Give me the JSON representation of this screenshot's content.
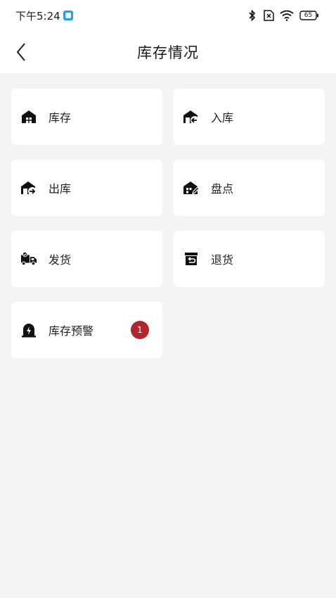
{
  "status_bar": {
    "time": "下午5:24",
    "battery": "65",
    "icons": [
      "app-notification-icon",
      "bluetooth-icon",
      "sim-off-icon",
      "wifi-icon",
      "battery-icon"
    ]
  },
  "nav": {
    "back_icon": "chevron-left-icon",
    "title": "库存情况"
  },
  "menu": {
    "items": [
      {
        "label": "库存",
        "icon": "warehouse-icon"
      },
      {
        "label": "入库",
        "icon": "warehouse-in-icon"
      },
      {
        "label": "出库",
        "icon": "warehouse-out-icon"
      },
      {
        "label": "盘点",
        "icon": "inventory-check-icon"
      },
      {
        "label": "发货",
        "icon": "delivery-truck-icon"
      },
      {
        "label": "退货",
        "icon": "return-box-icon"
      },
      {
        "label": "库存预警",
        "icon": "alert-warehouse-icon",
        "badge": "1"
      }
    ]
  },
  "colors": {
    "background": "#f4f4f4",
    "card": "#ffffff",
    "badge": "#b3262b",
    "status_accent": "#1ba3f0"
  }
}
